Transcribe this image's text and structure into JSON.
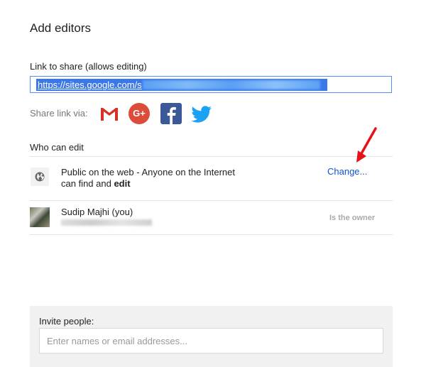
{
  "dialog": {
    "title": "Add editors"
  },
  "link": {
    "label": "Link to share (allows editing)",
    "value": "https://sites.google.com/s"
  },
  "share": {
    "label": "Share link via:",
    "icons": [
      "gmail-icon",
      "google-plus-icon",
      "facebook-icon",
      "twitter-icon"
    ],
    "gplus_text": "G+"
  },
  "who": {
    "label": "Who can edit",
    "public_line1": "Public on the web - Anyone on the Internet",
    "public_line2_prefix": "can find and ",
    "public_line2_bold": "edit",
    "change_label": "Change...",
    "user_name": "Sudip Majhi (you)",
    "owner_label": "Is the owner"
  },
  "invite": {
    "label": "Invite people:",
    "placeholder": "Enter names or email addresses..."
  },
  "colors": {
    "link_blue": "#1155cc",
    "selection_blue": "#3b78e7",
    "gmail_red": "#d93025",
    "gplus_red": "#dd4b39",
    "facebook_blue": "#3b5998",
    "twitter_blue": "#1da1f2",
    "arrow_red": "#e8111a"
  }
}
